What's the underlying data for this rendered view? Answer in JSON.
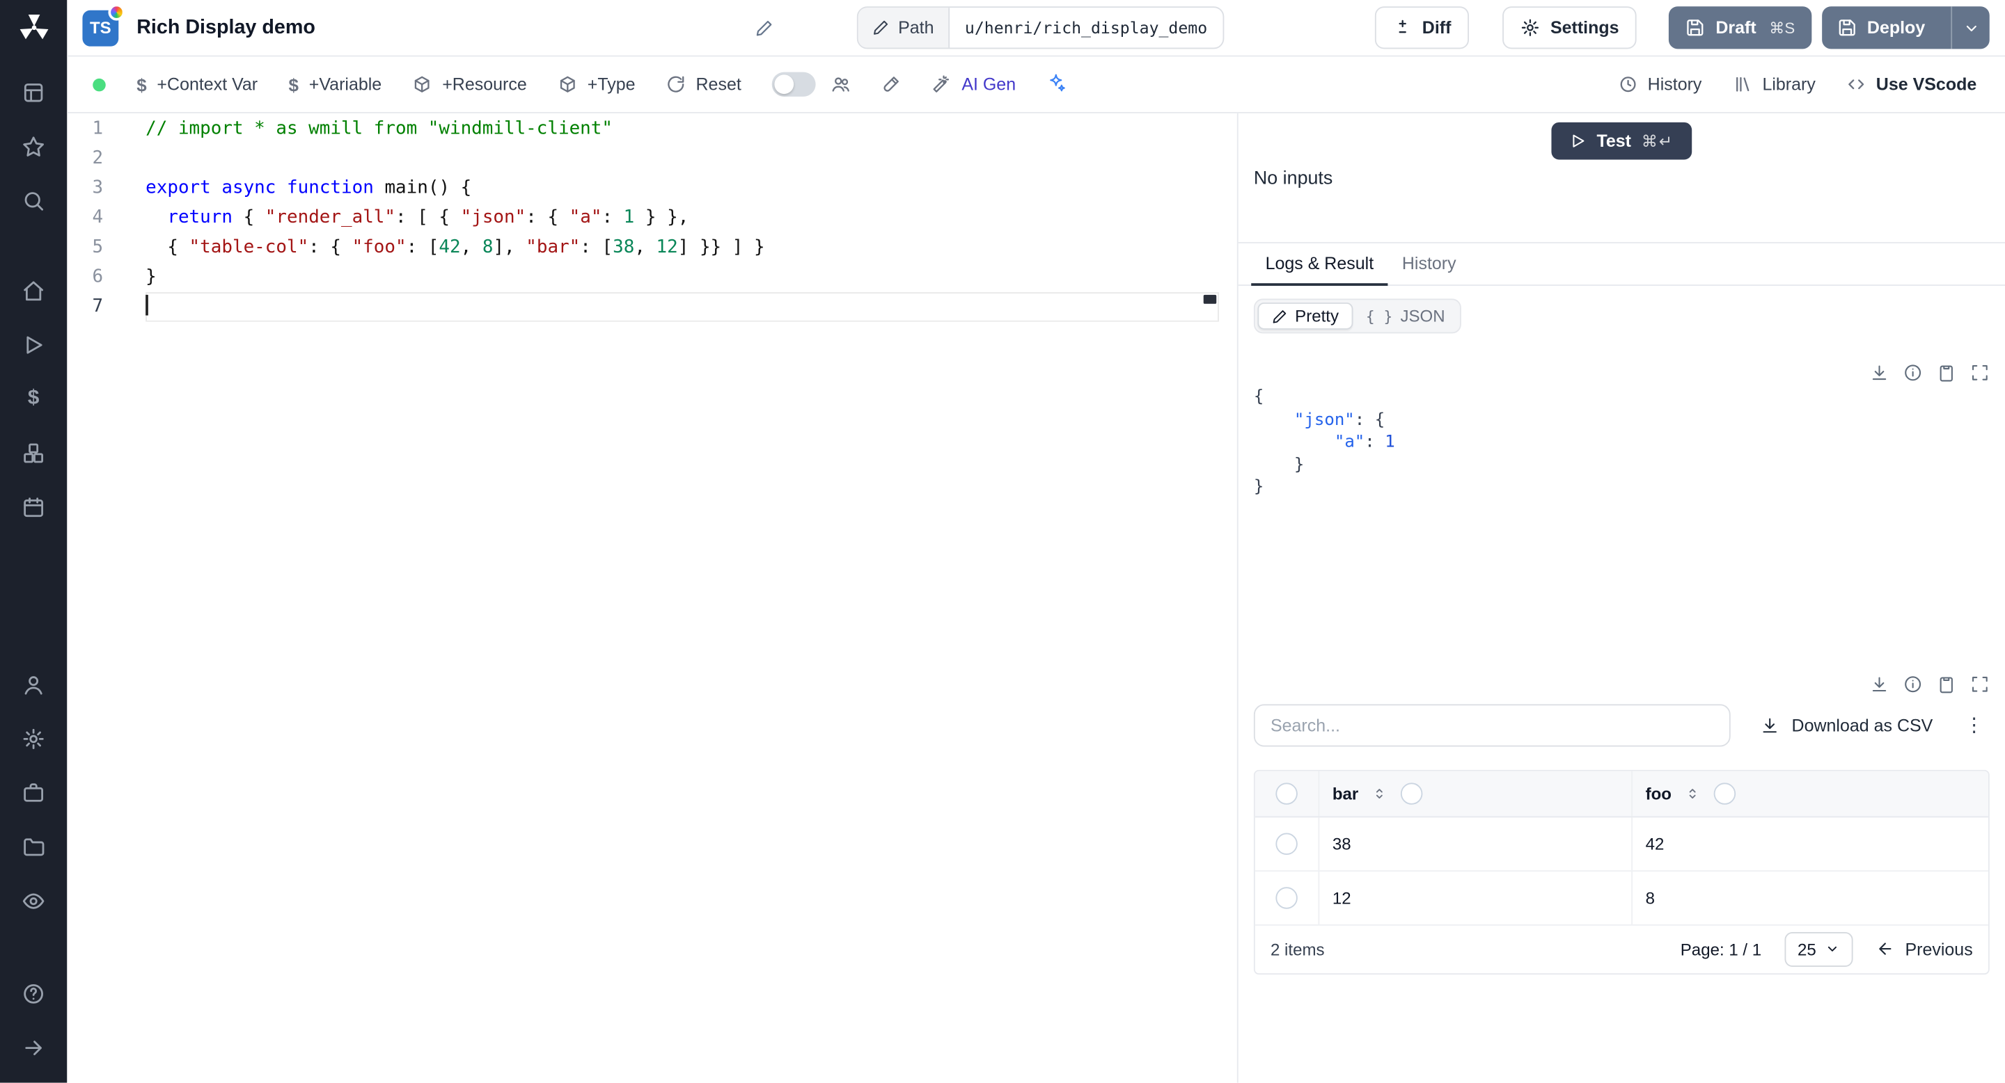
{
  "colors": {
    "sidebar_bg": "#1c212c",
    "ts_badge_blue": "#3076c9",
    "slate_button": "#64748b",
    "test_button_dark": "#353f54",
    "status_green": "#4ade80",
    "active_tab_underline": "#27303f",
    "border": "#e7e9ee",
    "json_key_blue": "#2563eb",
    "code_keyword": "#0000ff",
    "code_string": "#a31515",
    "code_number": "#098658",
    "code_comment": "#008000"
  },
  "icons": {
    "windmill-logo": "pinwheel",
    "apps-icon": "▦",
    "favorites-star-icon": "☆",
    "search-icon": "🔍",
    "home-icon": "⌂",
    "runs-play-icon": "▷",
    "variables-dollar-icon": "$",
    "resources-boxes-icon": "❒",
    "schedules-calendar-icon": "▤",
    "user-icon": "👤",
    "settings-gear-icon": "⚙",
    "workers-briefcase-icon": "💼",
    "folders-icon": "🗀",
    "audit-eye-icon": "👁",
    "help-icon": "?",
    "collapse-arrow-icon": "→",
    "edit-pencil-icon": "✎",
    "diff-icon": "±",
    "save-icon": "🖫",
    "chevron-down-icon": "⌄",
    "history-clock-icon": "🕐",
    "library-icon": "|||",
    "code-icon": "</>",
    "reset-icon": "⟳",
    "users-icon": "👥",
    "format-brush-icon": "🖌",
    "ai-wand-icon": "🪄",
    "sparkle-icon": "✦",
    "download-icon": "⭳",
    "info-icon": "ⓘ",
    "copy-icon": "⧉",
    "expand-icon": "⛶",
    "sort-icon": "⇅",
    "arrow-left-icon": "←",
    "kebab": "⋮",
    "braces": "{ }",
    "play-icon": "▶"
  },
  "header": {
    "lang_badge": "TS",
    "title": "Rich Display demo",
    "path_label": "Path",
    "path_value": "u/henri/rich_display_demo",
    "diff_label": "Diff",
    "settings_label": "Settings",
    "draft_label": "Draft",
    "draft_shortcut": "⌘S",
    "deploy_label": "Deploy"
  },
  "toolbar": {
    "context_var": "+Context Var",
    "variable": "+Variable",
    "resource": "+Resource",
    "type": "+Type",
    "reset": "Reset",
    "ai_gen": "AI Gen",
    "history": "History",
    "library": "Library",
    "vscode": "Use VScode"
  },
  "editor": {
    "language": "typescript",
    "cursor_line": 7,
    "lines": [
      [
        [
          "comment",
          "// import * as wmill from \"windmill-client\""
        ]
      ],
      [],
      [
        [
          "kw",
          "export"
        ],
        [
          "plain",
          " "
        ],
        [
          "kw",
          "async"
        ],
        [
          "plain",
          " "
        ],
        [
          "kw",
          "function"
        ],
        [
          "plain",
          " main() {"
        ]
      ],
      [
        [
          "plain",
          "  "
        ],
        [
          "kw",
          "return"
        ],
        [
          "plain",
          " { "
        ],
        [
          "str",
          "\"render_all\""
        ],
        [
          "plain",
          ": [ { "
        ],
        [
          "str",
          "\"json\""
        ],
        [
          "plain",
          ": { "
        ],
        [
          "str",
          "\"a\""
        ],
        [
          "plain",
          ": "
        ],
        [
          "num",
          "1"
        ],
        [
          "plain",
          " } },"
        ]
      ],
      [
        [
          "plain",
          "  { "
        ],
        [
          "str",
          "\"table-col\""
        ],
        [
          "plain",
          ": { "
        ],
        [
          "str",
          "\"foo\""
        ],
        [
          "plain",
          ": ["
        ],
        [
          "num",
          "42"
        ],
        [
          "plain",
          ", "
        ],
        [
          "num",
          "8"
        ],
        [
          "plain",
          "], "
        ],
        [
          "str",
          "\"bar\""
        ],
        [
          "plain",
          ": ["
        ],
        [
          "num",
          "38"
        ],
        [
          "plain",
          ", "
        ],
        [
          "num",
          "12"
        ],
        [
          "plain",
          "] }} ] }"
        ]
      ],
      [
        [
          "plain",
          "}"
        ]
      ],
      []
    ]
  },
  "runner": {
    "test_label": "Test",
    "test_shortcut": "⌘↵",
    "no_inputs": "No inputs",
    "tab_logs": "Logs & Result",
    "tab_history": "History",
    "view_pretty": "Pretty",
    "view_json": "JSON"
  },
  "result": {
    "lines": [
      [
        [
          "p",
          "{"
        ]
      ],
      [
        [
          "p",
          "    "
        ],
        [
          "key",
          "\"json\""
        ],
        [
          "p",
          ": {"
        ]
      ],
      [
        [
          "p",
          "        "
        ],
        [
          "key",
          "\"a\""
        ],
        [
          "p",
          ": "
        ],
        [
          "num",
          "1"
        ]
      ],
      [
        [
          "p",
          "    }"
        ]
      ],
      [
        [
          "p",
          "}"
        ]
      ]
    ]
  },
  "table": {
    "search_placeholder": "Search...",
    "download_csv": "Download as CSV",
    "columns": [
      "bar",
      "foo"
    ],
    "rows": [
      [
        "38",
        "42"
      ],
      [
        "12",
        "8"
      ]
    ],
    "items_label": "2 items",
    "page_label": "Page: 1 / 1",
    "page_size": "25",
    "previous_label": "Previous"
  }
}
